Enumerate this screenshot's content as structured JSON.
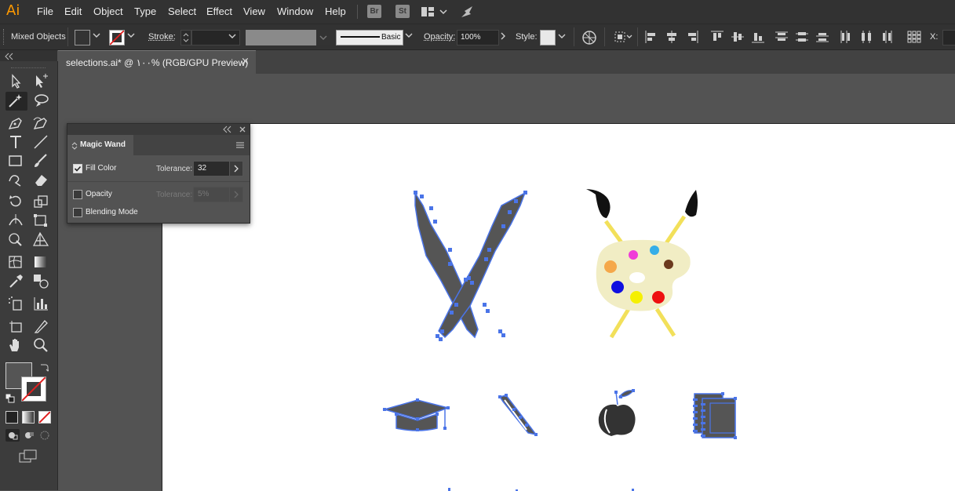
{
  "app": {
    "logo": "Ai"
  },
  "menu": {
    "items": [
      "File",
      "Edit",
      "Object",
      "Type",
      "Select",
      "Effect",
      "View",
      "Window",
      "Help"
    ],
    "br_badge": "Br",
    "st_badge": "St"
  },
  "control_bar": {
    "selection_label": "Mixed Objects",
    "stroke_label": "Stroke:",
    "brush_label": "Basic",
    "opacity_label": "Opacity:",
    "opacity_value": "100%",
    "style_label": "Style:",
    "x_label": "X:"
  },
  "document": {
    "tab_title": "selections.ai* @ ١٠٠% (RGB/GPU Preview)",
    "close_glyph": "×"
  },
  "magic_wand_panel": {
    "title": "Magic Wand",
    "fill_color_label": "Fill Color",
    "fill_color_checked": true,
    "fill_tolerance_label": "Tolerance:",
    "fill_tolerance_value": "32",
    "opacity_label": "Opacity",
    "opacity_checked": false,
    "opacity_tolerance_label": "Tolerance:",
    "opacity_tolerance_value": "5%",
    "blending_label": "Blending Mode",
    "blending_checked": false
  },
  "colors": {
    "selection_blue": "#4a74e8",
    "shape_gray": "#555555",
    "handle_yellow": "#f2e05a",
    "palette_cream": "#f1edc4",
    "paint_orange": "#f5a84a",
    "paint_magenta": "#f03cd8",
    "paint_cyan": "#36aee8",
    "paint_brown": "#6b3a1e",
    "paint_blue": "#1010e0",
    "paint_yellow": "#f5f000",
    "paint_red": "#ee1010"
  }
}
